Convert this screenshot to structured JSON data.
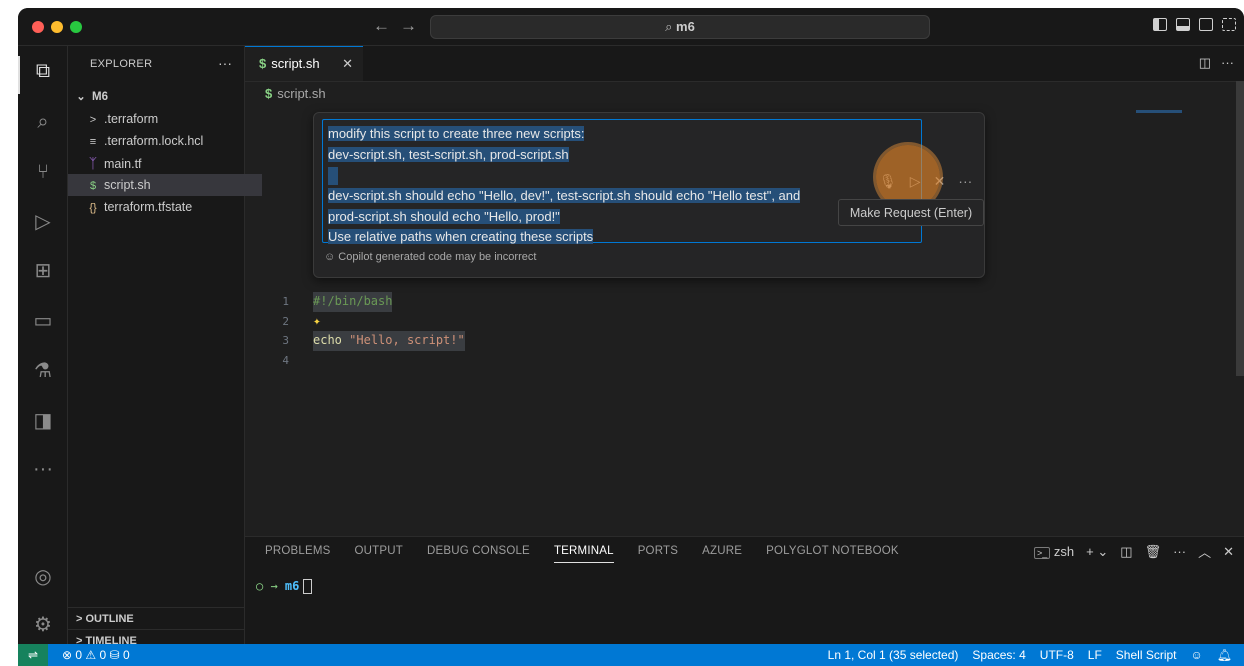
{
  "titlebar": {
    "back": "←",
    "forward": "→",
    "search_text": "m6"
  },
  "sidebar": {
    "title": "EXPLORER",
    "more": "···",
    "root": "M6",
    "items": [
      {
        "label": ".terraform",
        "icon": ">"
      },
      {
        "label": ".terraform.lock.hcl",
        "icon": "≡"
      },
      {
        "label": "main.tf",
        "icon": "terraform"
      },
      {
        "label": "script.sh",
        "icon": "$"
      },
      {
        "label": "terraform.tfstate",
        "icon": "{}"
      }
    ],
    "outline": "OUTLINE",
    "timeline": "TIMELINE"
  },
  "editor": {
    "tab_label": "script.sh",
    "tab_icon": "$",
    "breadcrumb": "script.sh",
    "inline_chat": {
      "lines": [
        "modify this script to create three new scripts:",
        "dev-script.sh, test-script.sh, prod-script.sh",
        "",
        "dev-script.sh should echo \"Hello, dev!\", test-script.sh should echo \"Hello test\", and",
        "prod-script.sh should echo \"Hello, prod!\"",
        "Use relative paths when creating these scripts"
      ],
      "disclaimer": "Copilot generated code may be incorrect",
      "tooltip": "Make Request (Enter)"
    },
    "code": [
      {
        "num": "1",
        "text": "#!/bin/bash"
      },
      {
        "num": "2",
        "text": ""
      },
      {
        "num": "3",
        "kw": "echo",
        "str": "\"Hello, script!\""
      },
      {
        "num": "4",
        "text": ""
      }
    ]
  },
  "panel": {
    "tabs": [
      "PROBLEMS",
      "OUTPUT",
      "DEBUG CONSOLE",
      "TERMINAL",
      "PORTS",
      "AZURE",
      "POLYGLOT NOTEBOOK"
    ],
    "terminal_name": "zsh",
    "prompt_arrow": "○ →",
    "prompt_dir": "m6"
  },
  "status": {
    "errors": "0",
    "warnings": "0",
    "ports": "0",
    "position": "Ln 1, Col 1 (35 selected)",
    "spaces": "Spaces: 4",
    "encoding": "UTF-8",
    "eol": "LF",
    "language": "Shell Script"
  }
}
